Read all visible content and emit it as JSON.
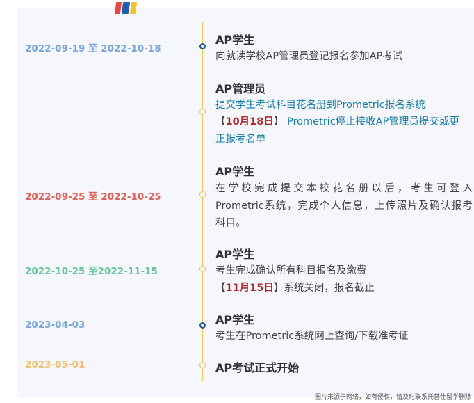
{
  "colors": {
    "line": "#f0c64a",
    "dot_filled": "#1e5b82",
    "date_blue": "#7ba7d8",
    "date_red": "#e0625a",
    "date_green": "#6cc79a",
    "date_orange": "#f2c26b",
    "highlight_red": "#b32a2a",
    "link_blue": "#1a7fa8"
  },
  "entries": [
    {
      "date": "2022-09-19 至 2022-10-18",
      "title": "AP学生",
      "lines": [
        "向就读学校AP管理员登记报名参加AP考试"
      ]
    },
    {
      "date": "",
      "title": "AP管理员",
      "line1": "提交学生考试科目花名册到Prometric报名系统",
      "bracket_open": "【",
      "highlight": "10月18日",
      "bracket_close": "】",
      "line2_rest": " Prometric停止接收AP管理员提交或更",
      "line3": "正报考名单"
    },
    {
      "date": "2022-09-25 至 2022-10-25",
      "title": "AP学生",
      "lines": [
        "在学校完成提交本校花名册以后，考生可登入",
        "Prometric系统，完成个人信息，上传照片及确认报考",
        "科目。"
      ]
    },
    {
      "date": "2022-10-25 至2022-11-15",
      "title": "AP学生",
      "line1": "考生完成确认所有科目报名及缴费",
      "bracket_open": "【",
      "highlight": "11月15日",
      "bracket_close": "】",
      "line2_rest": "系统关闭，报名截止"
    },
    {
      "date": "2023-04-03",
      "title": "AP学生",
      "lines": [
        "考生在Prometric系统网上查询/下载准考证"
      ]
    },
    {
      "date": "2023-05-01",
      "title": "AP考试正式开始"
    }
  ],
  "footer": "图片来源于网络，如有侵权，请及时联系托普仕留学删除"
}
